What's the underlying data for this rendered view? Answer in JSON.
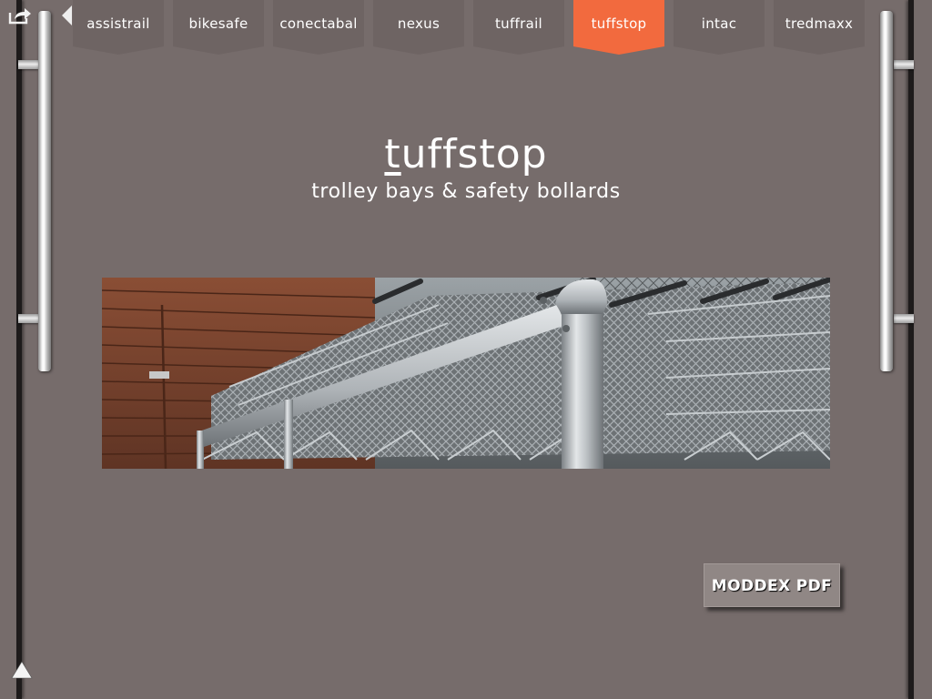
{
  "nav": {
    "tabs": [
      {
        "label": "assistrail"
      },
      {
        "label": "bikesafe"
      },
      {
        "label": "conectabal"
      },
      {
        "label": "nexus"
      },
      {
        "label": "tuffrail"
      },
      {
        "label": "tuffstop"
      },
      {
        "label": "intac"
      },
      {
        "label": "tredmaxx"
      }
    ],
    "active_tab": "tuffstop"
  },
  "page": {
    "title_first_letter": "t",
    "title_rest": "uffstop",
    "subtitle": "trolley bays & safety bollards"
  },
  "actions": {
    "pdf_label": "MODDEX PDF"
  },
  "icons": {
    "share": "share-icon",
    "previous": "left-triangle-icon",
    "scroll_up": "up-triangle-icon"
  },
  "colors": {
    "background": "#766c6b",
    "tab": "#6e6463",
    "tab_active": "#f26a3e",
    "text": "#ffffff"
  }
}
